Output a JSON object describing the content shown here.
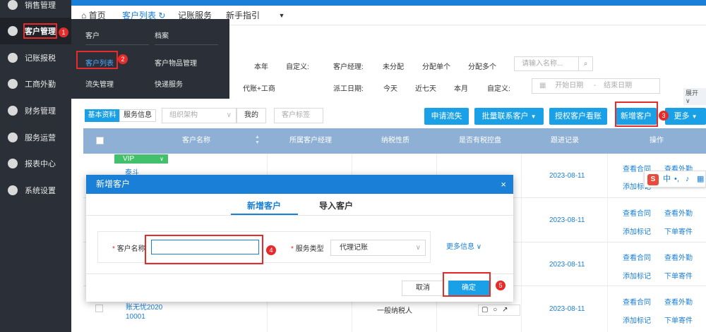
{
  "sidebar": {
    "items": [
      {
        "label": "销售管理",
        "icon": "sales-icon"
      },
      {
        "label": "客户管理",
        "icon": "user-icon"
      },
      {
        "label": "记账报税",
        "icon": "ledger-icon"
      },
      {
        "label": "工商外勤",
        "icon": "field-icon"
      },
      {
        "label": "财务管理",
        "icon": "finance-icon"
      },
      {
        "label": "服务运营",
        "icon": "operation-icon"
      },
      {
        "label": "报表中心",
        "icon": "report-icon"
      },
      {
        "label": "系统设置",
        "icon": "settings-icon"
      }
    ]
  },
  "tabs": {
    "home": "首页",
    "customer_list": "客户列表",
    "bookkeeping": "记账服务",
    "guide": "新手指引"
  },
  "flyout": {
    "customer": "客户",
    "archive": "档案",
    "customer_list": "客户列表",
    "items_mgmt": "客户物品管理",
    "churn": "流失管理",
    "express": "快递服务"
  },
  "filters": {
    "this_year": "本年",
    "custom1": "自定义:",
    "agent_biz": "代账+工商",
    "manager_label": "客户经理:",
    "unassigned": "未分配",
    "assign_one": "分配单个",
    "assign_many": "分配多个",
    "search_placeholder": "请输入名称...",
    "dispatch_label": "派工日期:",
    "today": "今天",
    "last7": "近七天",
    "this_month": "本月",
    "custom2": "自定义:",
    "start_date": "开始日期",
    "dash": "-",
    "end_date": "结束日期",
    "expand": "展开"
  },
  "toolbar": {
    "basic_info": "基本资料",
    "service_info": "服务信息",
    "org_placeholder": "组织架构",
    "mine": "我的",
    "tag_placeholder": "客户标签",
    "apply_churn": "申请流失",
    "bulk_contact": "批量联系客户",
    "authorize": "授权客户看账",
    "new_customer": "新增客户",
    "more": "更多"
  },
  "table": {
    "headers": [
      "客户名称",
      "所属客户经理",
      "纳税性质",
      "是否有税控盘",
      "跟进记录",
      "操作"
    ],
    "vip": "VIP",
    "rows": [
      {
        "date": "2023-08-11",
        "op1": "查看合同",
        "op2": "查看外勤",
        "op3": "添加标记",
        "op4": "下单寄件"
      },
      {
        "date": "2023-08-11",
        "op1": "查看合同",
        "op2": "查看外勤",
        "op3": "添加标记",
        "op4": "下单寄件"
      },
      {
        "date": "2023-08-11",
        "op1": "查看合同",
        "op2": "查看外勤",
        "op3": "添加标记",
        "op4": "下单寄件"
      },
      {
        "date": "2023-08-11",
        "op1": "查看合同",
        "op2": "查看外勤",
        "op3": "添加标记",
        "op4": "下单寄件"
      },
      {
        "date": "2023-08-11",
        "op1": "查看合同",
        "op2": "查看外勤",
        "op3": "添加标记",
        "op4": "下单寄件"
      }
    ],
    "last_name_line1": "账无忧2020",
    "last_name_line2": "10001",
    "last_tax": "一般纳税人",
    "partial_name": "泰斗"
  },
  "modal": {
    "title": "新增客户",
    "tab_add": "新增客户",
    "tab_import": "导入客户",
    "name_label": "客户名称",
    "service_label": "服务类型",
    "service_value": "代理记账",
    "more_info": "更多信息",
    "cancel": "取消",
    "ok": "确定",
    "required": "*"
  },
  "ime": {
    "cn": "中"
  },
  "badges": [
    "1",
    "2",
    "3",
    "4",
    "5"
  ]
}
